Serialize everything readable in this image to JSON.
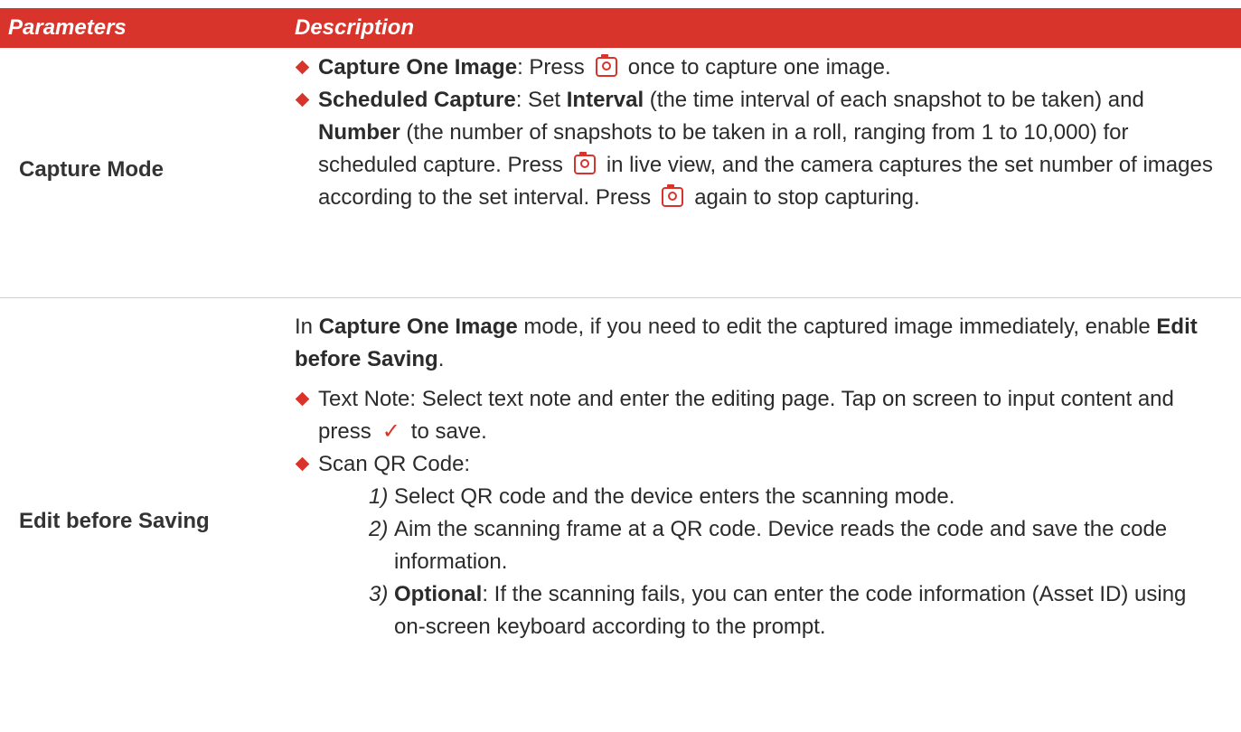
{
  "header": {
    "col1": "Parameters",
    "col2": "Description"
  },
  "row1": {
    "param": "Capture Mode",
    "b1_term": "Capture One Image",
    "b1_a": ": Press",
    "b1_b": "once to capture one image.",
    "b2_term": "Scheduled Capture",
    "b2_a": ": Set",
    "b2_interval": "Interval",
    "b2_b": "(the time interval of each snapshot to be taken) and",
    "b2_number": "Number",
    "b2_c": "(the number of snapshots to be taken in a roll, ranging from 1 to 10,000) for scheduled capture. Press",
    "b2_d": "in live view, and the camera captures the set number of images according to the set interval. Press",
    "b2_e": "again to stop capturing."
  },
  "row2": {
    "param": "Edit before Saving",
    "p_a": "In",
    "p_term": "Capture One Image",
    "p_b": "mode, if you need to edit the captured image immediately, enable",
    "p_term2": "Edit before Saving",
    "p_c": ".",
    "b1_a": "Text Note: Select text note and enter the editing page. Tap on screen to input content and press",
    "b1_b": "to save.",
    "b2": "Scan QR Code:",
    "s1_num": "1)",
    "s1": "Select QR code and the device enters the scanning mode.",
    "s2_num": "2)",
    "s2": "Aim the scanning frame at a QR code. Device reads the code and save the code information.",
    "s3_num": "3)",
    "s3_term": "Optional",
    "s3": ": If the scanning fails, you can enter the code information (Asset ID) using on-screen keyboard according to the prompt."
  },
  "icons": {
    "capture": "camera-icon",
    "confirm": "check-icon"
  },
  "colors": {
    "accent": "#d9342b"
  }
}
